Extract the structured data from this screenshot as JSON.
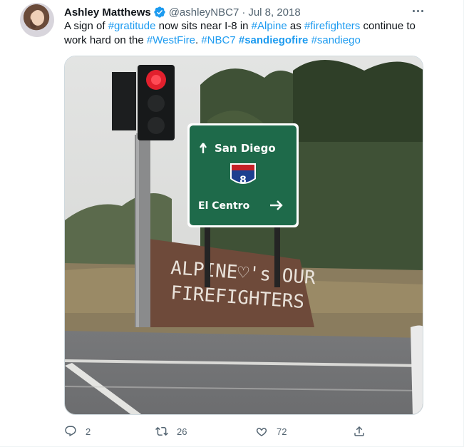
{
  "tweet": {
    "author_name": "Ashley Matthews",
    "handle": "@ashleyNBC7",
    "dot": "·",
    "date": "Jul 8, 2018",
    "text": {
      "p1": "A sign of ",
      "h1": "#gratitude",
      "p2": " now sits near I-8 in ",
      "h2": "#Alpine",
      "p3": " as ",
      "h3": "#firefighters",
      "p4": " continue to work hard on the ",
      "h4": "#WestFire",
      "p5": ". ",
      "h5": "#NBC7",
      "p6": " ",
      "h6": "#sandiegofire",
      "p7": " ",
      "h7": "#sandiego"
    },
    "image": {
      "sign_line1": "San Diego",
      "sign_shield": "8",
      "sign_line2": "El Centro",
      "wall_line1": "ALPINE♡'s OUR",
      "wall_line2": "FIREFIGHTERS"
    },
    "actions": {
      "reply_count": "2",
      "retweet_count": "26",
      "like_count": "72"
    }
  },
  "colors": {
    "link": "#1d9bf0",
    "secondary_text": "#536471",
    "verified": "#1d9bf0",
    "sign_green": "#1e6a4a"
  },
  "icons": [
    "verified-badge-icon",
    "more-icon",
    "reply-icon",
    "retweet-icon",
    "like-icon",
    "share-icon"
  ]
}
